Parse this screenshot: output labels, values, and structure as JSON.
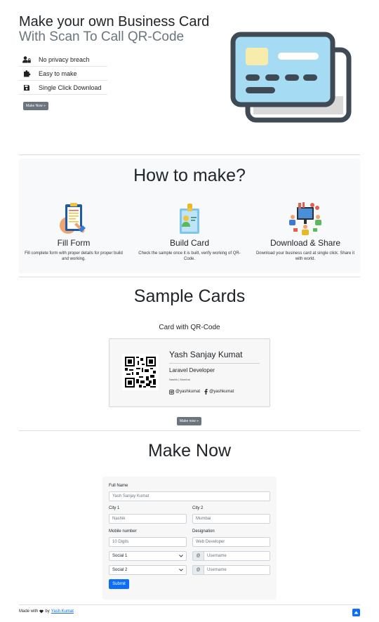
{
  "hero": {
    "title": "Make your own Business Card",
    "subtitle": "With Scan To Call QR-Code",
    "features": [
      {
        "icon": "user-lock-icon",
        "label": "No privacy breach"
      },
      {
        "icon": "puzzle-icon",
        "label": "Easy to make"
      },
      {
        "icon": "save-icon",
        "label": "Single Click Download"
      }
    ],
    "cta": "Make Now »",
    "illustration": "credit-card-illustration"
  },
  "how": {
    "title": "How to make?",
    "steps": [
      {
        "icon": "clipboard-form-icon",
        "title": "Fill Form",
        "text": "Fill complete form with proper details for proper build and working."
      },
      {
        "icon": "id-badge-icon",
        "title": "Build Card",
        "text": "Check the sample once it is built, verify working of QR-Code."
      },
      {
        "icon": "share-people-icon",
        "title": "Download & Share",
        "text": "Download your business card at single click. Share it with world."
      }
    ]
  },
  "sample": {
    "title": "Sample Cards",
    "subtitle": "Card with QR-Code",
    "card": {
      "name": "Yash Sanjay Kumat",
      "role": "Laravel Developer",
      "location": "Nashik | Mumbai",
      "instagram": "@yashkumat",
      "facebook": "@yashkumat"
    },
    "cta": "Make now »"
  },
  "make": {
    "title": "Make Now",
    "fields": {
      "full_name_label": "Full Name",
      "full_name_placeholder": "Yash Sanjay Kumat",
      "city1_label": "City 1",
      "city1_placeholder": "Nashik",
      "city2_label": "City 2",
      "city2_placeholder": "Mumbai",
      "mobile_label": "Mobile number",
      "mobile_placeholder": "10 Digits",
      "designation_label": "Designation",
      "designation_placeholder": "Web Developer",
      "social1_selected": "Social 1",
      "social2_selected": "Social 2",
      "username_prefix": "@",
      "username_placeholder": "Username"
    },
    "submit": "Submit"
  },
  "footer": {
    "made_with": "Made with",
    "by": "by",
    "author": "Yash Kumat"
  },
  "colors": {
    "primary": "#0d6efd",
    "muted": "#6c757d",
    "card_blue": "#a6dcf3",
    "card_dark": "#3f4a54"
  }
}
